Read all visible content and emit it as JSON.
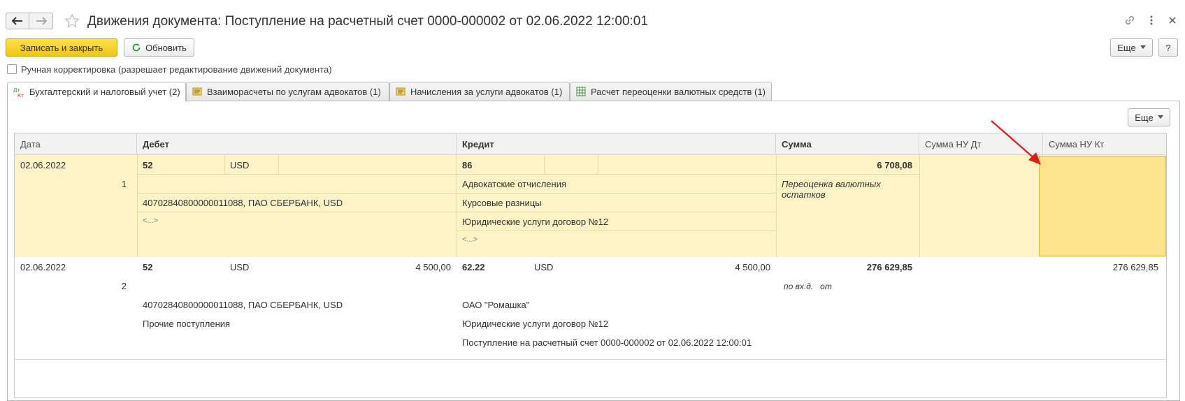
{
  "window": {
    "title": "Движения документа: Поступление на расчетный счет 0000-000002 от 02.06.2022 12:00:01",
    "icons": [
      "back-arrow-icon",
      "forward-arrow-icon",
      "star-icon",
      "link-icon",
      "more-vertical-icon",
      "close-icon"
    ]
  },
  "toolbar": {
    "save_close_label": "Записать и закрыть",
    "refresh_label": "Обновить",
    "more_label": "Еще",
    "help_label": "?"
  },
  "manual_edit": {
    "label": "Ручная корректировка (разрешает редактирование движений документа)",
    "checked": false
  },
  "tabs": [
    {
      "label": "Бухгалтерский и налоговый учет (2)",
      "icon": "dt-kt-icon",
      "active": true
    },
    {
      "label": "Взаиморасчеты по услугам адвокатов (1)",
      "icon": "register-icon",
      "active": false
    },
    {
      "label": "Начисления за услуги адвокатов (1)",
      "icon": "register-icon",
      "active": false
    },
    {
      "label": "Расчет переоценки валютных средств (1)",
      "icon": "table-icon",
      "active": false
    }
  ],
  "table": {
    "more_label": "Еще",
    "columns": [
      "Дата",
      "Дебет",
      "Кредит",
      "Сумма",
      "Сумма НУ Дт",
      "Сумма НУ Кт"
    ],
    "rows": [
      {
        "date": "02.06.2022",
        "num": "1",
        "debit_account": "52",
        "debit_currency": "USD",
        "debit_amount": "",
        "debit_sub1": "40702840800000011088, ПАО СБЕРБАНК, USD",
        "debit_sub2": "<...>",
        "credit_account": "86",
        "credit_currency": "",
        "credit_amount": "",
        "credit_sub1": "Адвокатские отчисления",
        "credit_sub2": "Курсовые разницы",
        "credit_sub3": "Юридические услуги договор №12",
        "credit_sub4": "<...>",
        "sum": "6 708,08",
        "content": "Переоценка валютных остатков",
        "sum_nu_dt": "",
        "sum_nu_kt": ""
      },
      {
        "date": "02.06.2022",
        "num": "2",
        "debit_account": "52",
        "debit_currency": "USD",
        "debit_amount": "4 500,00",
        "debit_sub1": "40702840800000011088, ПАО СБЕРБАНК, USD",
        "debit_sub2": "Прочие поступления",
        "credit_account": "62.22",
        "credit_currency": "USD",
        "credit_amount": "4 500,00",
        "credit_sub1": "ОАО \"Ромашка\"",
        "credit_sub2": "Юридические услуги договор №12",
        "credit_sub3": "Поступление на расчетный счет 0000-000002 от 02.06.2022 12:00:01",
        "sum": "276 629,85",
        "content": "по вх.д.   от",
        "sum_nu_dt": "",
        "sum_nu_kt": "276 629,85"
      }
    ]
  },
  "colors": {
    "primary_button": "#f5cf20",
    "selected_row": "#fdf3c6",
    "selected_cell": "#fde38e",
    "annotation_red": "#e21b1b"
  }
}
